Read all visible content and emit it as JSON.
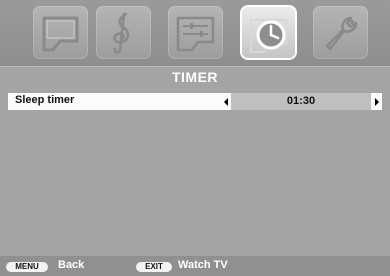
{
  "menu_tabs": [
    {
      "name": "picture",
      "icon": "tv-screen-icon",
      "active": false
    },
    {
      "name": "sound",
      "icon": "treble-clef-icon",
      "active": false
    },
    {
      "name": "setup",
      "icon": "slider-panel-icon",
      "active": false
    },
    {
      "name": "timer",
      "icon": "clock-icon",
      "active": true
    },
    {
      "name": "installation",
      "icon": "wrench-icon",
      "active": false
    }
  ],
  "page": {
    "title": "TIMER"
  },
  "settings": [
    {
      "label": "Sleep timer",
      "value": "01:30"
    }
  ],
  "footer": {
    "menu_key": "MENU",
    "menu_action": "Back",
    "exit_key": "EXIT",
    "exit_action": "Watch TV"
  },
  "colors": {
    "background": "#a4a4a4",
    "selected_row": "#fbfbfb",
    "value_box": "#bfbfbf"
  }
}
